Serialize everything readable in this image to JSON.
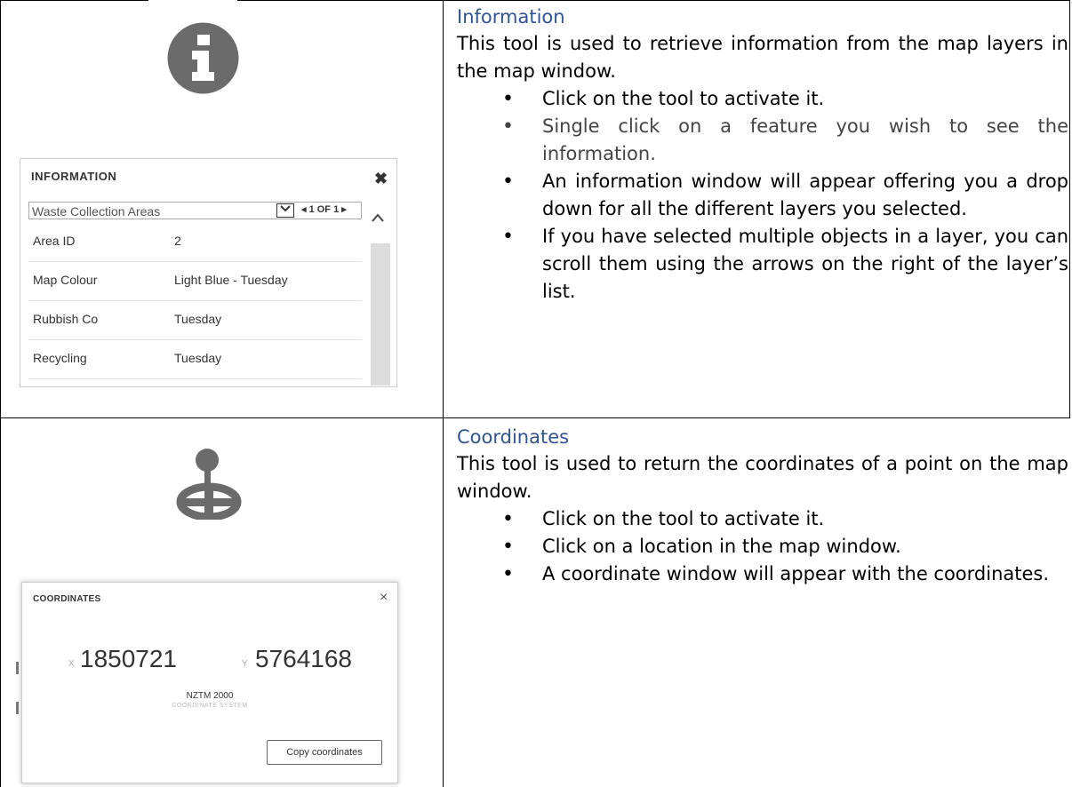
{
  "information": {
    "heading": "Information",
    "intro": "This tool is used to retrieve information from the map layers in the map window.",
    "bullets": [
      "Click on the tool to activate it.",
      "Single click on a feature you wish to see the information.",
      "An information window will appear offering you a drop down for all the different layers you selected.",
      "If you have selected multiple objects in a layer, you can scroll them using the arrows on the right of the layer’s list."
    ],
    "icon": "info-circle-icon",
    "panel": {
      "title": "INFORMATION",
      "close": "✖",
      "layer_select": "Waste Collection Areas",
      "pager": "◂ 1 OF 1 ▸",
      "rows": [
        {
          "key": "Area ID",
          "value": "2"
        },
        {
          "key": "Map Colour",
          "value": "Light Blue - Tuesday"
        },
        {
          "key": "Rubbish Co",
          "value": "Tuesday"
        },
        {
          "key": "Recycling",
          "value": "Tuesday"
        }
      ]
    }
  },
  "coordinates": {
    "heading": "Coordinates",
    "intro": "This tool is used to return the coordinates of a point on the map window.",
    "bullets": [
      "Click on the tool to activate it.",
      "Click on a location in the map window.",
      "A coordinate window will appear with the coordinates."
    ],
    "icon": "map-pin-target-icon",
    "panel": {
      "title": "COORDINATES",
      "close": "×",
      "x_label": "X",
      "x_value": "1850721",
      "y_label": "Y",
      "y_value": "5764168",
      "crs": "NZTM 2000",
      "crs_label": "COORDINATE SYSTEM",
      "copy_button": "Copy coordinates"
    }
  },
  "colors": {
    "heading": "#2f5496",
    "icon": "#6b6b6b"
  }
}
